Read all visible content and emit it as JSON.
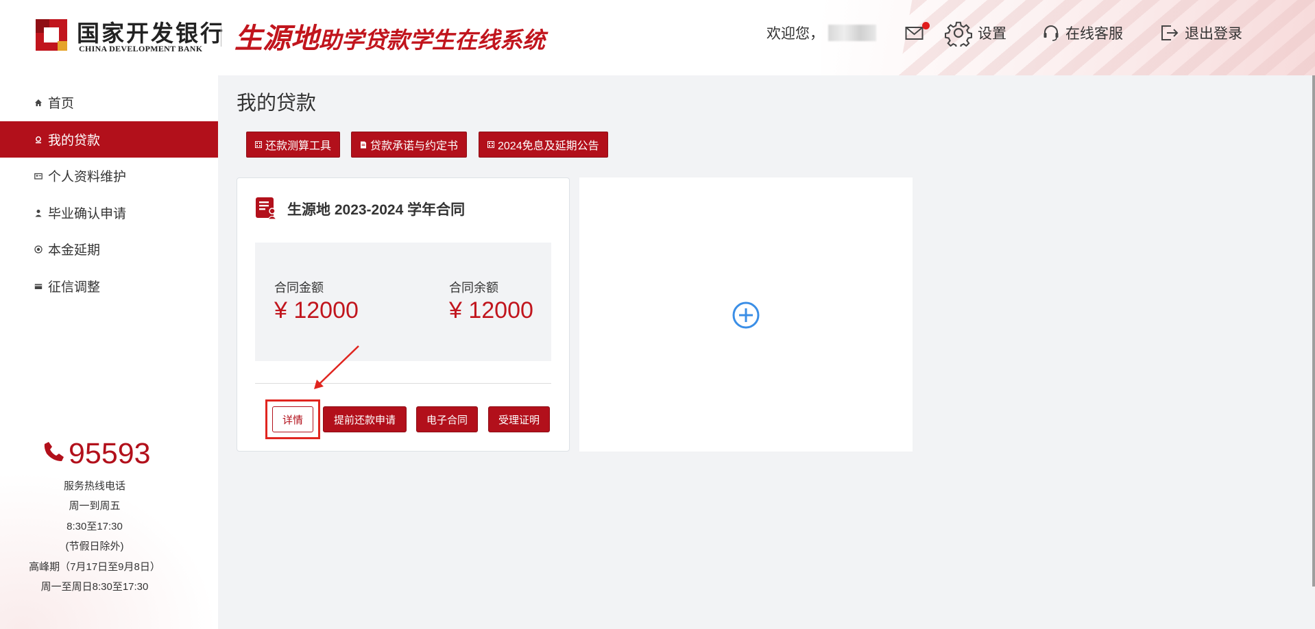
{
  "header": {
    "bank_name_cn": "国家开发银行",
    "bank_name_en": "CHINA DEVELOPMENT BANK",
    "system_title_part1": "生源地",
    "system_title_part2": "助学贷款学生在线系统",
    "welcome": "欢迎您，",
    "settings": "设置",
    "online_service": "在线客服",
    "logout": "退出登录",
    "icons": [
      "mail-icon",
      "gear-icon",
      "headset-icon",
      "logout-icon"
    ],
    "unread_dot_color": "#e01b1b"
  },
  "sidebar": {
    "items": [
      {
        "label": "首页",
        "icon": "home-icon",
        "active": false
      },
      {
        "label": "我的贷款",
        "icon": "loan-icon",
        "active": true
      },
      {
        "label": "个人资料维护",
        "icon": "profile-card-icon",
        "active": false
      },
      {
        "label": "毕业确认申请",
        "icon": "person-icon",
        "active": false
      },
      {
        "label": "本金延期",
        "icon": "target-icon",
        "active": false
      },
      {
        "label": "征信调整",
        "icon": "credit-card-icon",
        "active": false
      }
    ],
    "hotline": {
      "number": "95593",
      "lines": [
        "服务热线电话",
        "周一到周五",
        "8:30至17:30",
        "(节假日除外)",
        "高峰期（7月17日至9月8日）",
        "周一至周日8:30至17:30"
      ]
    }
  },
  "main": {
    "title": "我的贷款",
    "tools": [
      "还款测算工具",
      "贷款承诺与约定书",
      "2024免息及延期公告"
    ],
    "contract": {
      "title": "生源地 2023-2024 学年合同",
      "amount_label": "合同金额",
      "amount_value": "¥ 12000",
      "balance_label": "合同余额",
      "balance_value": "¥ 12000",
      "buttons": [
        "详情",
        "提前还款申请",
        "电子合同",
        "受理证明"
      ]
    },
    "add_contract_icon": "plus-circle-icon"
  },
  "colors": {
    "brand_red": "#b2101b",
    "amount_red": "#c1151d",
    "main_bg": "#f2f3f5",
    "add_icon_blue": "#3a8ee6"
  }
}
